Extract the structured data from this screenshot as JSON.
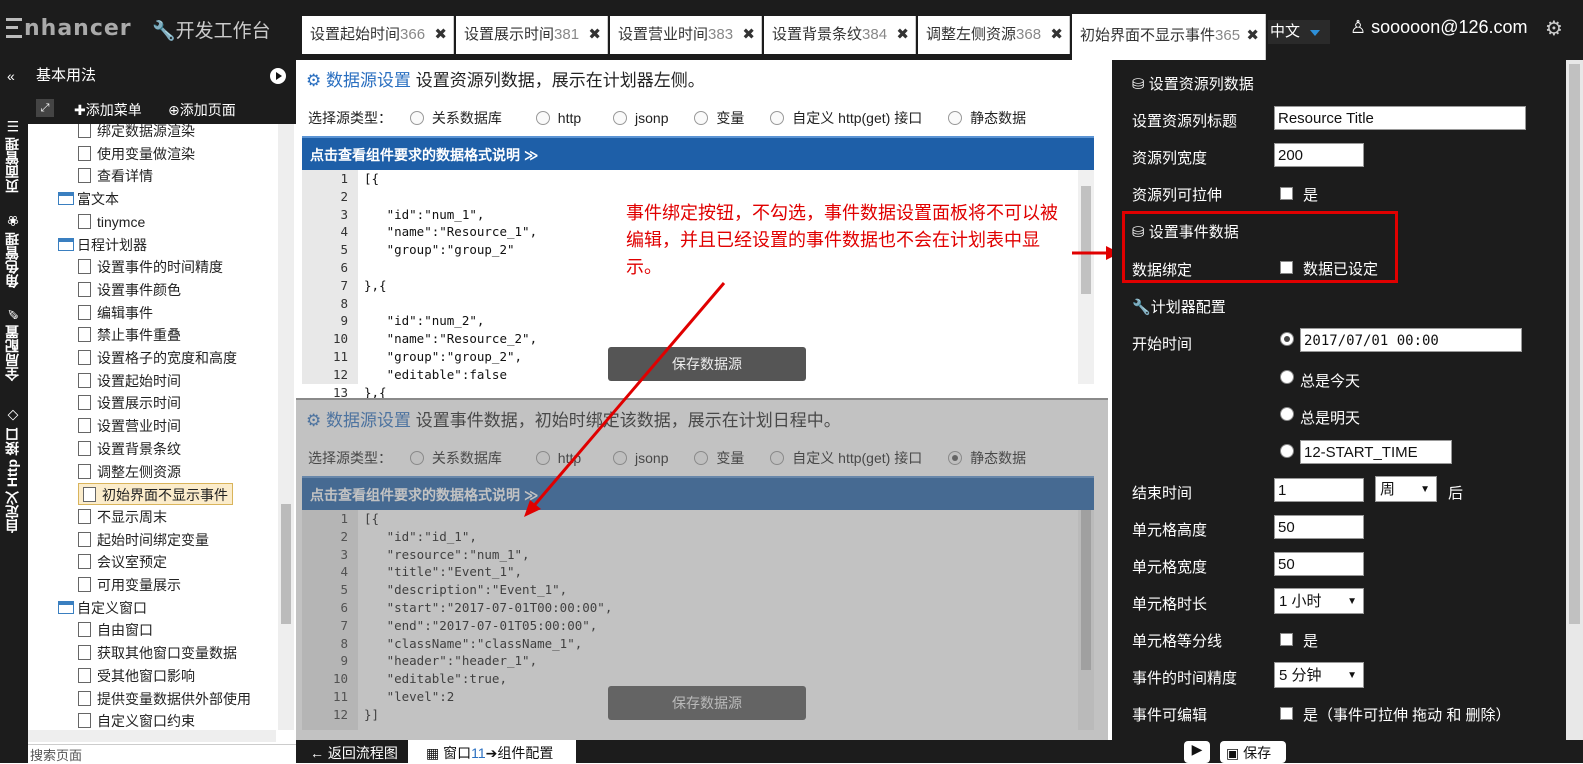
{
  "app": {
    "logo": "nhancer",
    "dev_title": "开发工作台",
    "language": "中文",
    "user": "sooooon@126.com"
  },
  "tabs": [
    {
      "label": "设置起始时间",
      "num": "366"
    },
    {
      "label": "设置展示时间",
      "num": "381"
    },
    {
      "label": "设置营业时间",
      "num": "383"
    },
    {
      "label": "设置背景条纹",
      "num": "384"
    },
    {
      "label": "调整左侧资源",
      "num": "368"
    },
    {
      "label": "初始界面不显示事件",
      "num": "365"
    }
  ],
  "side_tabs": [
    "页面管理",
    "角色管理",
    "全局配置",
    "自定义 Http 接口"
  ],
  "left": {
    "header": "基本用法",
    "add_menu": "添加菜单",
    "add_page": "添加页面",
    "search_placeholder": "搜索页面",
    "tree": [
      {
        "label": "绑定数据源渲染",
        "type": "doc"
      },
      {
        "label": "使用变量做渲染",
        "type": "doc"
      },
      {
        "label": "查看详情",
        "type": "doc"
      },
      {
        "label": "富文本",
        "type": "folder"
      },
      {
        "label": "tinymce",
        "type": "doc"
      },
      {
        "label": "日程计划器",
        "type": "folder"
      },
      {
        "label": "设置事件的时间精度",
        "type": "doc"
      },
      {
        "label": "设置事件颜色",
        "type": "doc"
      },
      {
        "label": "编辑事件",
        "type": "doc"
      },
      {
        "label": "禁止事件重叠",
        "type": "doc"
      },
      {
        "label": "设置格子的宽度和高度",
        "type": "doc"
      },
      {
        "label": "设置起始时间",
        "type": "doc"
      },
      {
        "label": "设置展示时间",
        "type": "doc"
      },
      {
        "label": "设置营业时间",
        "type": "doc"
      },
      {
        "label": "设置背景条纹",
        "type": "doc"
      },
      {
        "label": "调整左侧资源",
        "type": "doc"
      },
      {
        "label": "初始界面不显示事件",
        "type": "doc",
        "selected": true
      },
      {
        "label": "不显示周末",
        "type": "doc"
      },
      {
        "label": "起始时间绑定变量",
        "type": "doc"
      },
      {
        "label": "会议室预定",
        "type": "doc"
      },
      {
        "label": "可用变量展示",
        "type": "doc"
      },
      {
        "label": "自定义窗口",
        "type": "folder"
      },
      {
        "label": "自由窗口",
        "type": "doc"
      },
      {
        "label": "获取其他窗口变量数据",
        "type": "doc"
      },
      {
        "label": "受其他窗口影响",
        "type": "doc"
      },
      {
        "label": "提供变量数据供外部使用",
        "type": "doc"
      },
      {
        "label": "自定义窗口约束",
        "type": "doc"
      }
    ]
  },
  "source_types": [
    "关系数据库",
    "http",
    "jsonp",
    "变量",
    "自定义 http(get) 接口",
    "静态数据"
  ],
  "section1": {
    "title": "数据源设置",
    "desc": "设置资源列数据，展示在计划器左侧。",
    "type_label": "选择源类型：",
    "format_bar": "点击查看组件要求的数据格式说明 ≫",
    "save": "保存数据源",
    "lines": [
      "[{",
      "",
      "   \"id\":\"num_1\",",
      "   \"name\":\"Resource_1\",",
      "   \"group\":\"group_2\"",
      "",
      "},{",
      "",
      "   \"id\":\"num_2\",",
      "   \"name\":\"Resource_2\",",
      "   \"group\":\"group_2\",",
      "   \"editable\":false",
      "},{"
    ]
  },
  "section2": {
    "title": "数据源设置",
    "desc": "设置事件数据，初始时绑定该数据，展示在计划日程中。",
    "type_label": "选择源类型：",
    "format_bar": "点击查看组件要求的数据格式说明 ≫",
    "save": "保存数据源",
    "lines": [
      "[{",
      "   \"id\":\"id_1\",",
      "   \"resource\":\"num_1\",",
      "   \"title\":\"Event_1\",",
      "   \"description\":\"Event_1\",",
      "   \"start\":\"2017-07-01T00:00:00\",",
      "   \"end\":\"2017-07-01T05:00:00\",",
      "   \"className\":\"className_1\",",
      "   \"header\":\"header_1\",",
      "   \"editable\":true,",
      "   \"level\":2",
      "}]"
    ]
  },
  "annotation": "事件绑定按钮，不勾选，事件数据设置面板将不可以被编辑，并且已经设置的事件数据也不会在计划表中显示。",
  "right": {
    "res_header": "设置资源列数据",
    "res_title_label": "设置资源列标题",
    "res_title_value": "Resource Title",
    "res_width_label": "资源列宽度",
    "res_width_value": "200",
    "res_stretch_label": "资源列可拉伸",
    "yes": "是",
    "event_header": "设置事件数据",
    "bind_label": "数据绑定",
    "bind_value": "数据已设定",
    "planner_header": "计划器配置",
    "start_label": "开始时间",
    "start_value": "2017/07/01 00:00",
    "today": "总是今天",
    "tomorrow": "总是明天",
    "start_var": "12-START_TIME",
    "end_label": "结束时间",
    "end_value": "1",
    "end_unit": "周",
    "end_suffix": "后",
    "cell_h_label": "单元格高度",
    "cell_h_value": "50",
    "cell_w_label": "单元格宽度",
    "cell_w_value": "50",
    "cell_dur_label": "单元格时长",
    "cell_dur_value": "1 小时",
    "cell_div_label": "单元格等分线",
    "precision_label": "事件的时间精度",
    "precision_value": "5 分钟",
    "editable_label": "事件可编辑",
    "editable_value": "是（事件可拉伸 拖动 和 删除）"
  },
  "bottom": {
    "back": "返回流程图",
    "window": "窗口",
    "window_num": "11",
    "config": "组件配置",
    "save": "保存"
  },
  "colors": {
    "accent": "#1e5fa8",
    "annotation": "#e00000",
    "dark": "#1c1c1c"
  }
}
